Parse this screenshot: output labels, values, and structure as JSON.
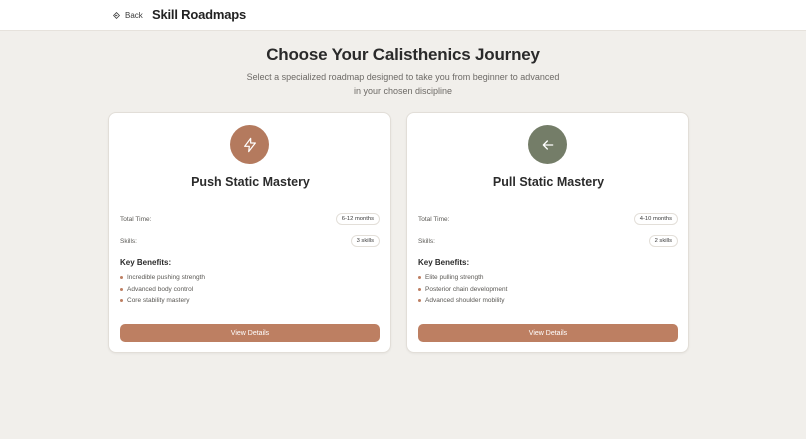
{
  "header": {
    "back_label": "Back",
    "back_icon": "diamond-arrow-icon",
    "title": "Skill Roadmaps"
  },
  "hero": {
    "title": "Choose Your Calisthenics Journey",
    "subtitle_line1": "Select a specialized roadmap designed to take you from beginner to advanced",
    "subtitle_line2": "in your chosen discipline"
  },
  "colors": {
    "accent": "#bd7f62",
    "push_icon_bg": "#b47a5e",
    "pull_icon_bg": "#747d68",
    "background": "#f1efeb"
  },
  "roadmaps": [
    {
      "icon": "lightning-bolt-icon",
      "title": "Push Static Mastery",
      "total_time_label": "Total Time:",
      "total_time_value": "6-12 months",
      "skills_label": "Skills:",
      "skills_value": "3 skills",
      "benefits_title": "Key Benefits:",
      "benefits": [
        "Incredible pushing strength",
        "Advanced body control",
        "Core stability mastery"
      ],
      "button_label": "View Details"
    },
    {
      "icon": "arrow-left-icon",
      "title": "Pull Static Mastery",
      "total_time_label": "Total Time:",
      "total_time_value": "4-10 months",
      "skills_label": "Skills:",
      "skills_value": "2 skills",
      "benefits_title": "Key Benefits:",
      "benefits": [
        "Elite pulling strength",
        "Posterior chain development",
        "Advanced shoulder mobility"
      ],
      "button_label": "View Details"
    }
  ]
}
